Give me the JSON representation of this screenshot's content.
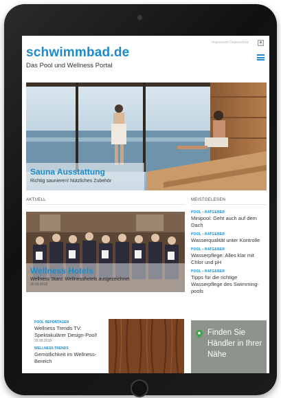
{
  "site": {
    "logo": "schwimmbad.de",
    "tagline": "Das Pool und Wellness Portal",
    "header_meta": "Impressum   Datenschutz"
  },
  "hero": {
    "title": "Sauna Ausstattung",
    "subtitle": "Richtig saunieren! Nützliches Zubehör"
  },
  "sections": {
    "current": "AKTUELL",
    "most_read": "MEISTGELESEN"
  },
  "feature": {
    "title": "Wellness Hotels",
    "subtitle": "Wellness Stars: Wellnesshotels ausgezeichnet",
    "date": "26.09.2018"
  },
  "most_read": [
    {
      "category": "POOL › RATGEBER",
      "title": "Minipool: Geht auch auf dem Dach"
    },
    {
      "category": "POOL › RATGEBER",
      "title": "Wasserqualität unter Kontrolle"
    },
    {
      "category": "POOL › RATGEBER",
      "title": "Wasserpflege: Alles klar mit Chlor und pH"
    },
    {
      "category": "POOL › RATGEBER",
      "title": "Tipps für die richtige Wasserpflege des Swimming-pools"
    }
  ],
  "mini_articles": [
    {
      "category": "POOL REPORTAGEN",
      "title": "Wellness Trends TV: Spektakulärer Design-Pool!",
      "date": "26.09.2018"
    },
    {
      "category": "WELLNESS TRENDS",
      "title": "Gemütlichkeit im Wellness-Bereich",
      "date": ""
    }
  ],
  "finder": {
    "text": "Finden Sie Händler in Ihrer Nähe"
  },
  "colors": {
    "brand": "#1e8bc9",
    "device": "#1a1a1a"
  }
}
